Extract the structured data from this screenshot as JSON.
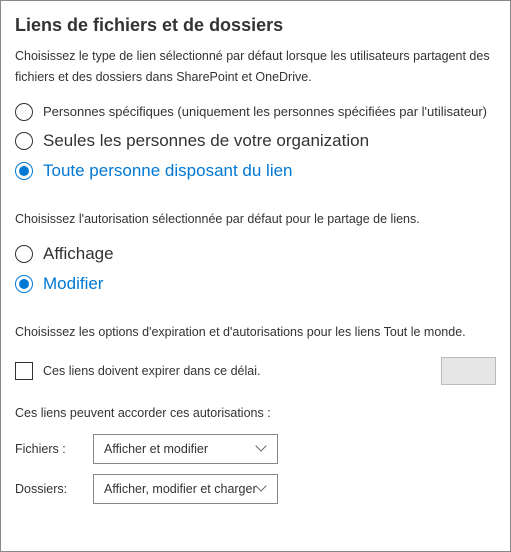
{
  "heading": "Liens de fichiers et de dossiers",
  "linkTypeDesc": "Choisissez le type de lien sélectionné par défaut lorsque les utilisateurs partagent des fichiers et des dossiers dans SharePoint et OneDrive.",
  "linkType": {
    "options": [
      {
        "label": "Personnes spécifiques (uniquement les personnes spécifiées par l'utilisateur)",
        "selected": false
      },
      {
        "label": "Seules les personnes de votre organization",
        "selected": false
      },
      {
        "label": "Toute personne disposant du lien",
        "selected": true
      }
    ]
  },
  "permDesc": "Choisissez l'autorisation sélectionnée par défaut pour le partage de liens.",
  "perm": {
    "options": [
      {
        "label": "Affichage",
        "selected": false
      },
      {
        "label": "Modifier",
        "selected": true
      }
    ]
  },
  "anyoneDesc": "Choisissez les options d'expiration et d'autorisations pour les liens Tout le monde.",
  "expireLabel": "Ces liens doivent expirer dans ce délai.",
  "grantDesc": "Ces liens peuvent accorder ces autorisations :",
  "filesLabel": "Fichiers :",
  "foldersLabel": "Dossiers:",
  "filesSelect": "Afficher et modifier",
  "foldersSelect": "Afficher, modifier et charger"
}
